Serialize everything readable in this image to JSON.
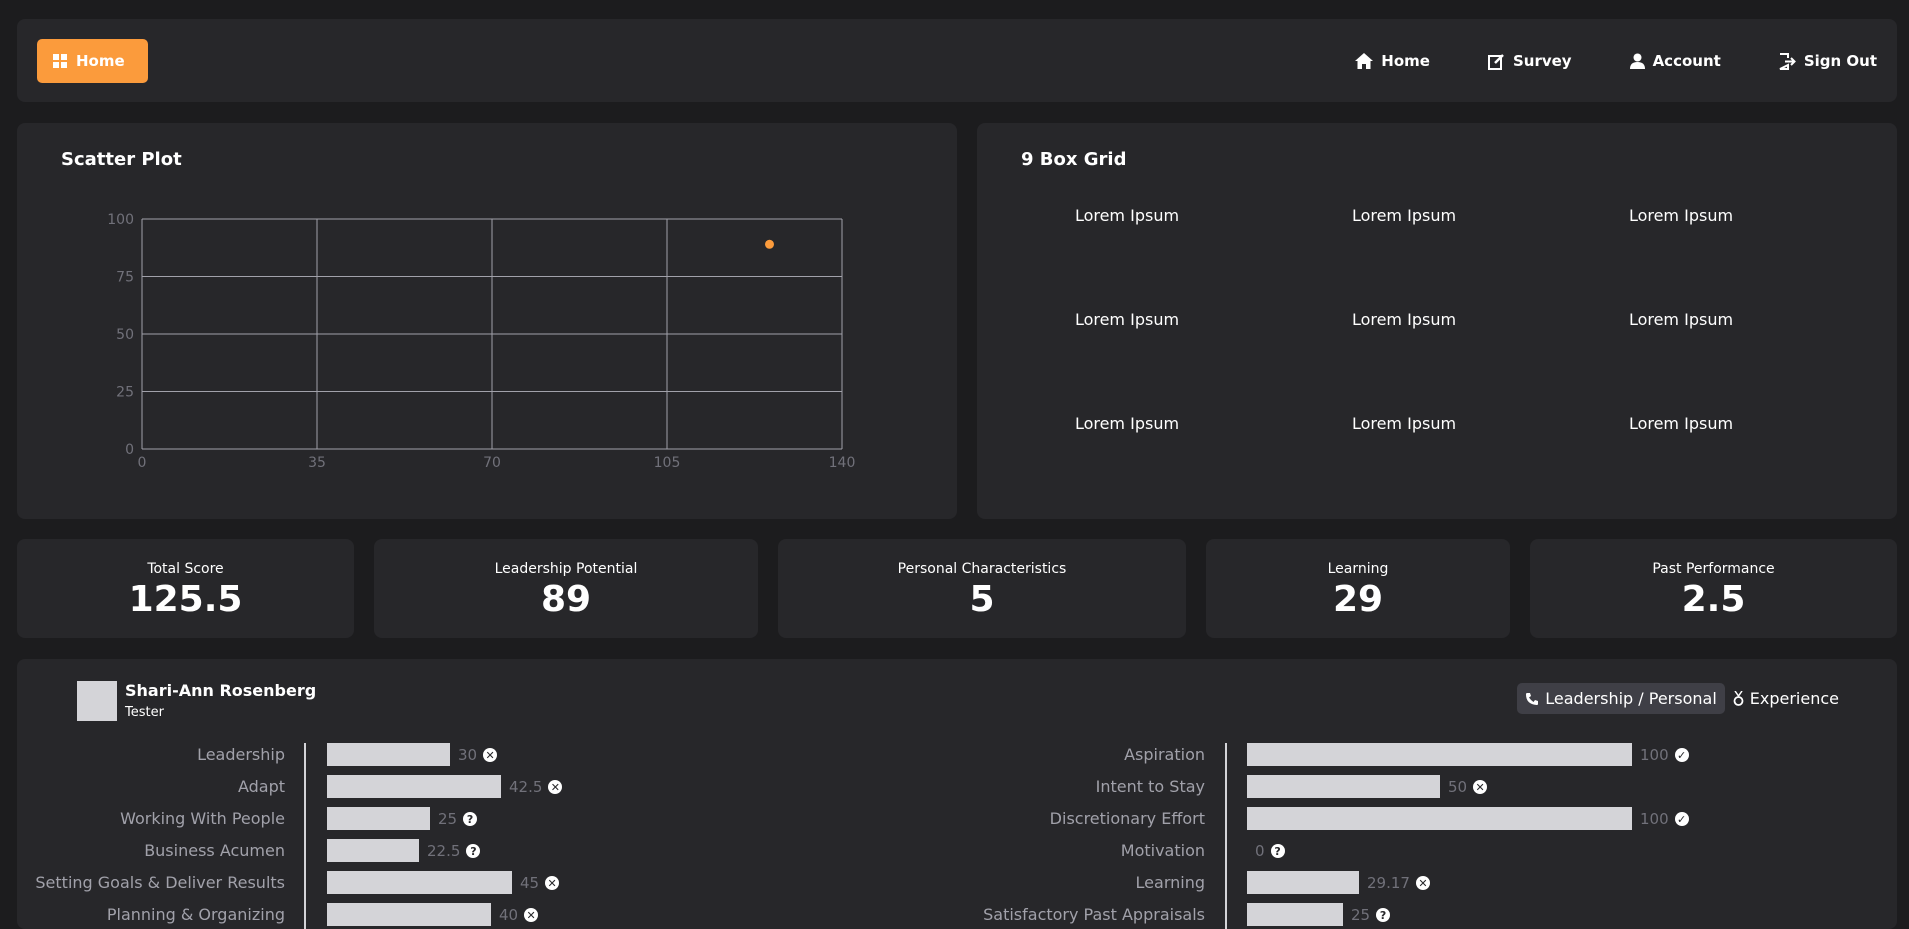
{
  "header": {
    "home_button": "Home",
    "nav": [
      {
        "label": "Home",
        "icon": "home-icon"
      },
      {
        "label": "Survey",
        "icon": "edit-icon"
      },
      {
        "label": "Account",
        "icon": "user-icon"
      },
      {
        "label": "Sign Out",
        "icon": "sign-out-icon"
      }
    ],
    "accent": "#fb9b3c"
  },
  "scatter": {
    "title": "Scatter Plot",
    "chart_data": {
      "type": "scatter",
      "title": "Scatter Plot",
      "x": [
        125.5
      ],
      "y": [
        89
      ],
      "xlim": [
        0,
        140
      ],
      "ylim": [
        0,
        100
      ],
      "xticks": [
        0,
        35,
        70,
        105,
        140
      ],
      "yticks": [
        0,
        25,
        50,
        75,
        100
      ],
      "grid": true,
      "point_color": "#fb9b3c"
    }
  },
  "nine_box": {
    "title": "9 Box Grid",
    "cells": [
      "Lorem Ipsum",
      "Lorem Ipsum",
      "Lorem Ipsum",
      "Lorem Ipsum",
      "Lorem Ipsum",
      "Lorem Ipsum",
      "Lorem Ipsum",
      "Lorem Ipsum",
      "Lorem Ipsum"
    ]
  },
  "stats": [
    {
      "label": "Total Score",
      "value": "125.5"
    },
    {
      "label": "Leadership Potential",
      "value": "89"
    },
    {
      "label": "Personal Characteristics",
      "value": "5"
    },
    {
      "label": "Learning",
      "value": "29"
    },
    {
      "label": "Past Performance",
      "value": "2.5"
    }
  ],
  "profile": {
    "name": "Shari-Ann Rosenberg",
    "role": "Tester",
    "tabs": [
      {
        "label": "Leadership / Personal",
        "icon": "phone-icon",
        "active": true
      },
      {
        "label": "Experience",
        "icon": "medal-icon",
        "active": false
      }
    ],
    "left_metrics": [
      {
        "label": "Leadership",
        "value": "30",
        "fraction": 0.3,
        "status": "x"
      },
      {
        "label": "Adapt",
        "value": "42.5",
        "fraction": 0.425,
        "status": "x"
      },
      {
        "label": "Working With People",
        "value": "25",
        "fraction": 0.25,
        "status": "?"
      },
      {
        "label": "Business Acumen",
        "value": "22.5",
        "fraction": 0.225,
        "status": "?"
      },
      {
        "label": "Setting Goals & Deliver Results",
        "value": "45",
        "fraction": 0.45,
        "status": "x"
      },
      {
        "label": "Planning & Organizing",
        "value": "40",
        "fraction": 0.4,
        "status": "x"
      }
    ],
    "right_metrics": [
      {
        "label": "Aspiration",
        "value": "100",
        "fraction": 1.0,
        "status": "check"
      },
      {
        "label": "Intent to Stay",
        "value": "50",
        "fraction": 0.5,
        "status": "x"
      },
      {
        "label": "Discretionary Effort",
        "value": "100",
        "fraction": 1.0,
        "status": "check"
      },
      {
        "label": "Motivation",
        "value": "0",
        "fraction": 0,
        "status": "?"
      },
      {
        "label": "Learning",
        "value": "29.17",
        "fraction": 0.2917,
        "status": "x"
      },
      {
        "label": "Satisfactory Past Appraisals",
        "value": "25",
        "fraction": 0.25,
        "status": "?"
      }
    ]
  }
}
